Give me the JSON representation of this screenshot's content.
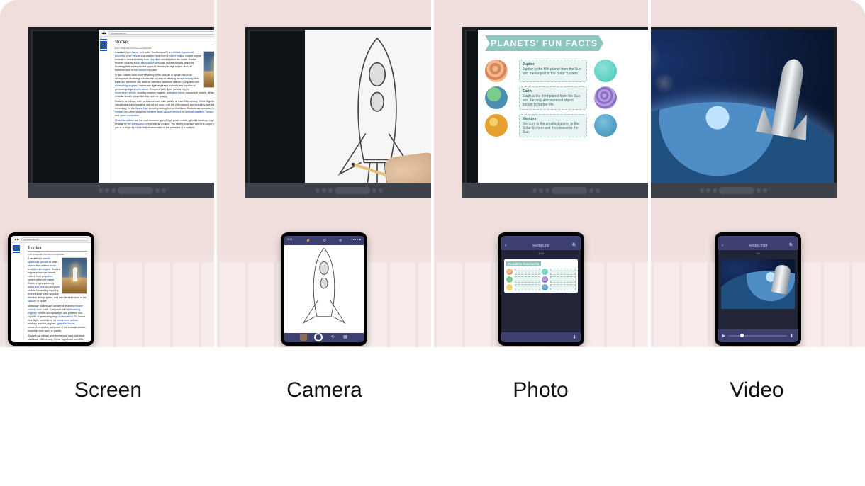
{
  "labels": [
    "Screen",
    "Camera",
    "Photo",
    "Video"
  ],
  "wiki": {
    "url": "en.wikipedia.org",
    "logo": "WIKIPEDIA",
    "title": "Rocket",
    "from": "From Wikipedia, the free encyclopedia"
  },
  "facts": {
    "banner": "PLANETS' FUN FACTS",
    "items": [
      {
        "name": "Jupiter",
        "text": "Jupiter is the fifth planet from the Sun and the largest in the Solar System."
      },
      {
        "name": "Earth",
        "text": "Earth is the third planet from the Sun and the only astronomical object known to harbor life."
      },
      {
        "name": "Mercury",
        "text": "Mercury is the smallest planet in the Solar System and the closest to the Sun."
      }
    ]
  },
  "camera": {
    "time": "9:41",
    "indicators": "●●● ▸ ■"
  },
  "photoViewer": {
    "filename": "Rocket.jpg",
    "meta": "1/16"
  },
  "videoViewer": {
    "filename": "Rocket.mp4",
    "meta": "1/4"
  }
}
